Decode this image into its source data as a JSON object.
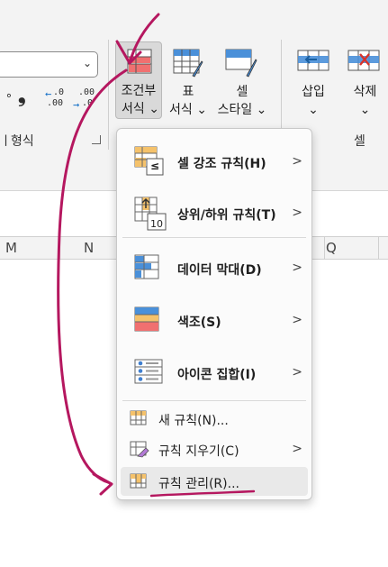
{
  "ribbon": {
    "number_group_label": "형식",
    "number_group_prefix": "ㅣ",
    "comma_glyph": "❟",
    "increase_decimal": {
      "top": ".0",
      "bottom": ".00",
      "arrow": "←"
    },
    "decrease_decimal": {
      "top": ".00",
      "bottom": ".0",
      "arrow": "→"
    },
    "cells_group_label": "셀",
    "conditional_format": {
      "line1": "조건부",
      "line2": "서식",
      "chevron": "⌄"
    },
    "table_format": {
      "line1": "표",
      "line2": "서식",
      "chevron": "⌄"
    },
    "cell_style": {
      "line1": "셀",
      "line2": "스타일",
      "chevron": "⌄"
    },
    "insert": {
      "label": "삽입",
      "chevron": "⌄"
    },
    "delete": {
      "label": "삭제",
      "chevron": "⌄"
    },
    "dropdown_chevron": "⌄"
  },
  "columns": [
    "M",
    "N",
    "Q"
  ],
  "menu": {
    "items": [
      {
        "label": "셀 강조 규칙(H)",
        "submenu": true,
        "bold": true
      },
      {
        "label": "상위/하위 규칙(T)",
        "submenu": true,
        "bold": true
      },
      {
        "label": "데이터 막대(D)",
        "submenu": true,
        "bold": true
      },
      {
        "label": "색조(S)",
        "submenu": true,
        "bold": true
      },
      {
        "label": "아이콘 집합(I)",
        "submenu": true,
        "bold": true
      },
      {
        "label": "새 규칙(N)...",
        "submenu": false,
        "bold": false
      },
      {
        "label": "규칙 지우기(C)",
        "submenu": true,
        "bold": false
      },
      {
        "label": "규칙 관리(R)...",
        "submenu": false,
        "bold": false
      }
    ],
    "submenu_arrow": ">",
    "icon_top_number": "10",
    "icon_less_than": "≤"
  },
  "colors": {
    "annotation": "#b5175f",
    "highlight_red": "#f07070",
    "blue": "#4a90d9"
  }
}
